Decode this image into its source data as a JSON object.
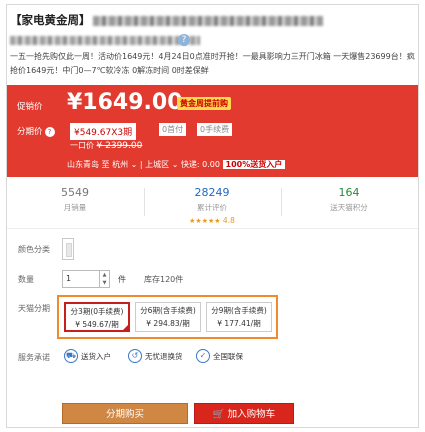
{
  "product": {
    "title": "【家电黄金周】",
    "promo_text": "一五一抢先购仅此一周！活动价1649元！4月24日0点准时开抢！一最具影响力三开门冰箱 一天爆售23699台！疯抢价1649元！中门0—7℃软冷冻 0解冻时间 0时差保鲜"
  },
  "price": {
    "promo_label": "促销价",
    "promo_price": "¥1649.00",
    "promo_tag": "黄金周提前购",
    "installment_label": "分期价",
    "installment_icon": "?",
    "installment_value": "¥549.67X3期",
    "fee_tag_1": "0首付",
    "fee_tag_2": "0手续费",
    "once_label": "一口价",
    "once_price": "¥ 2399.00"
  },
  "shipping": {
    "from": "山东青岛",
    "to_label": "至",
    "city": "杭州",
    "district": "上城区",
    "express": "快递: 0.00",
    "badge": "100%送货入户"
  },
  "stats": [
    {
      "num": "5549",
      "label": "月销量"
    },
    {
      "num": "28249",
      "label": "累计评价",
      "rating": "4.8",
      "stars": "★★★★★"
    },
    {
      "num": "164",
      "label": "送天猫积分"
    }
  ],
  "options": {
    "color_label": "颜色分类",
    "qty_label": "数量",
    "qty_value": "1",
    "qty_unit": "件",
    "stock": "库存120件",
    "installment_label": "天猫分期",
    "installments": [
      {
        "line1": "分3期(0手续费)",
        "line2": "¥ 549.67/期"
      },
      {
        "line1": "分6期(含手续费)",
        "line2": "¥ 294.83/期"
      },
      {
        "line1": "分9期(含手续费)",
        "line2": "¥ 177.41/期"
      }
    ],
    "service_label": "服务承诺",
    "services": [
      "送货入户",
      "无忧退换货",
      "全国联保"
    ]
  },
  "buttons": {
    "installment_buy": "分期购买",
    "add_to_cart": "加入购物车"
  },
  "colors": {
    "price_bg": "#e23a2e",
    "accent": "#f08a2a",
    "cart": "#d9261c",
    "buy": "#d08744"
  }
}
